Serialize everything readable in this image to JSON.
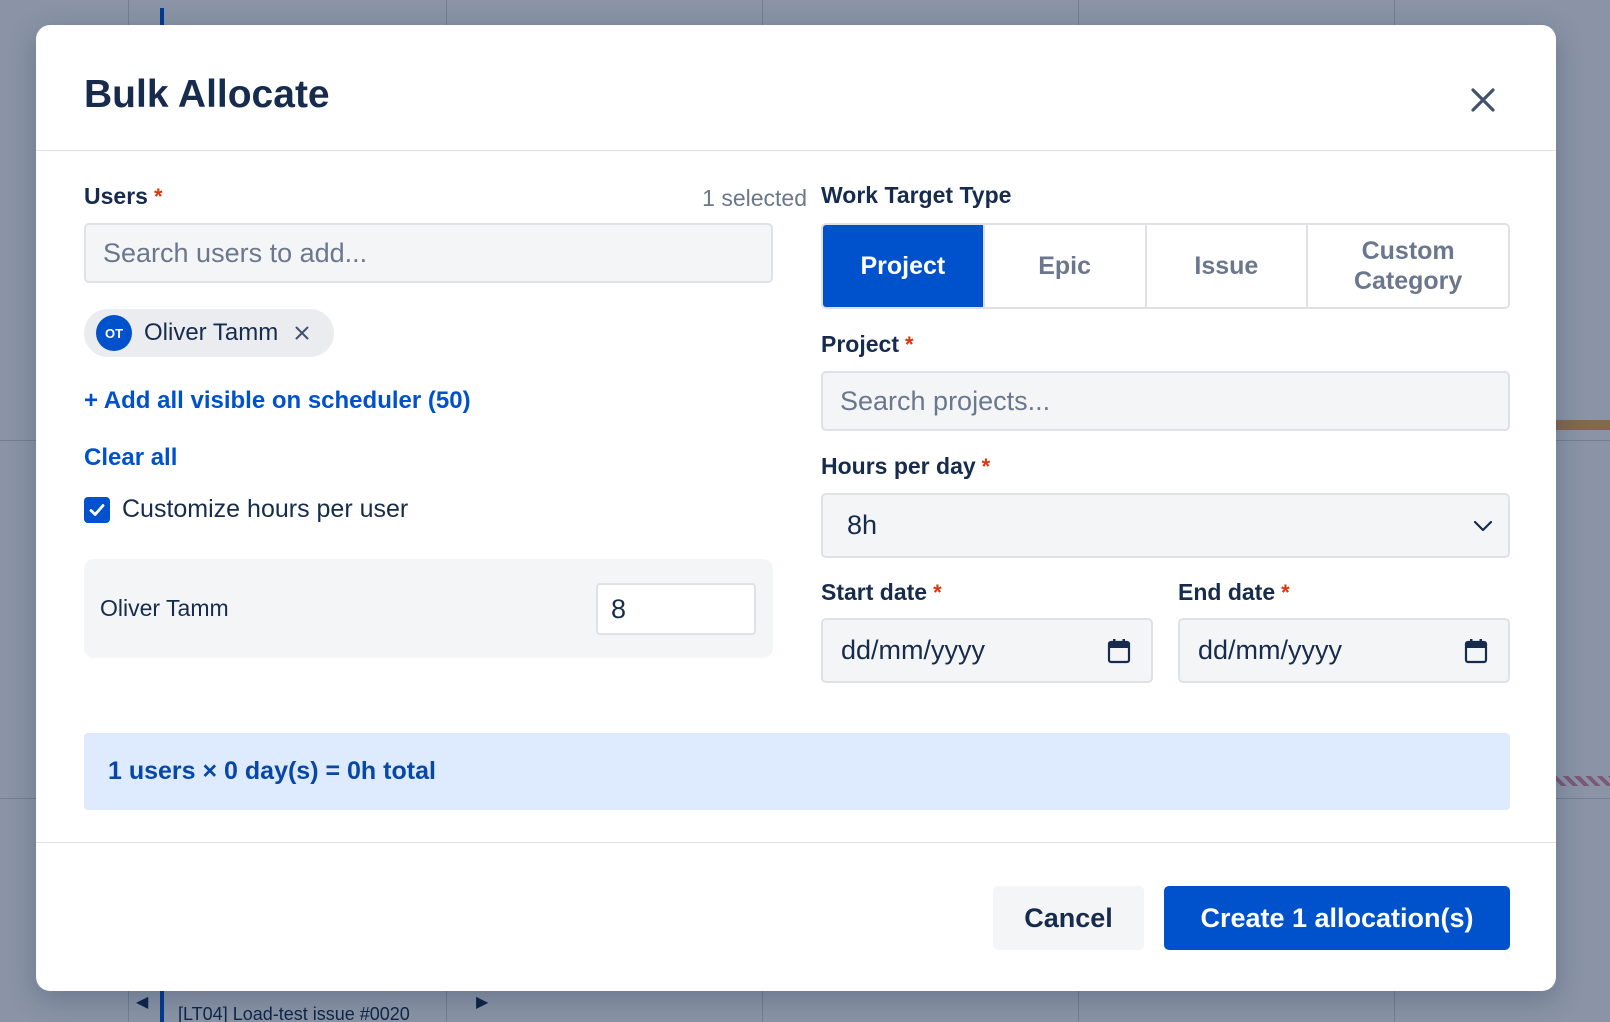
{
  "background": {
    "row_label": "[LT04] Load-test issue #0020"
  },
  "modal": {
    "title": "Bulk Allocate",
    "close_icon": "close-icon"
  },
  "users": {
    "label": "Users",
    "required_mark": "*",
    "selected_count": "1 selected",
    "search_placeholder": "Search users to add...",
    "chips": [
      {
        "initials": "OT",
        "name": "Oliver Tamm"
      }
    ],
    "add_all_link": "+ Add all visible on scheduler (50)",
    "clear_all_link": "Clear all",
    "customize_checkbox": {
      "label": "Customize hours per user",
      "checked": true
    },
    "per_user_hours": [
      {
        "name": "Oliver Tamm",
        "hours": "8"
      }
    ]
  },
  "work_target": {
    "label": "Work Target Type",
    "options": [
      "Project",
      "Epic",
      "Issue",
      "Custom Category"
    ],
    "selected": "Project"
  },
  "project": {
    "label": "Project",
    "required_mark": "*",
    "search_placeholder": "Search projects..."
  },
  "hours_per_day": {
    "label": "Hours per day",
    "required_mark": "*",
    "value": "8h"
  },
  "start_date": {
    "label": "Start date",
    "required_mark": "*",
    "placeholder": "dd/mm/yyyy"
  },
  "end_date": {
    "label": "End date",
    "required_mark": "*",
    "placeholder": "dd/mm/yyyy"
  },
  "summary": {
    "text": "1 users × 0 day(s) = 0h total"
  },
  "footer": {
    "cancel_label": "Cancel",
    "create_label": "Create 1 allocation(s)"
  },
  "colors": {
    "primary": "#0052cc",
    "required": "#de350b",
    "summary_bg": "#deebff",
    "text": "#172b4d",
    "muted": "#6b778c"
  }
}
